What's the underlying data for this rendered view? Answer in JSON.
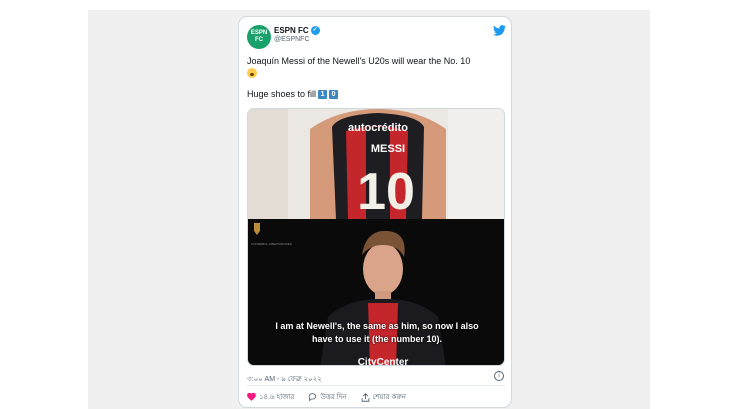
{
  "account": {
    "avatar_text": "ESPN FC",
    "name": "ESPN FC",
    "handle": "@ESPNFC"
  },
  "tweet": {
    "text": "Joaquín Messi of the Newell's U20s will wear the No. 10",
    "line2": "Huge shoes to fill",
    "keycap1": "1",
    "keycap2": "0"
  },
  "media": {
    "jersey_sponsor": "autocrédito",
    "jersey_name": "MESSI",
    "jersey_number": "10",
    "caption_line1": "I am at Newell's, the same as him, so now I also",
    "caption_line2": "have to use it (the number 10).",
    "shirt_sponsor": "CityCenter",
    "watermark": "CONMEBOL LIBERTADORES"
  },
  "timestamp": "৩:০০ AM - ৯ ফেব্রু ২০২২",
  "actions": {
    "likes": "১৪.৬ হাজার",
    "reply": "উত্তর দিন",
    "share": "শেয়ার করুন"
  },
  "colors": {
    "twitter_blue": "#1d9bf0",
    "espn_green": "#1aa06b",
    "like_red": "#f91880"
  }
}
